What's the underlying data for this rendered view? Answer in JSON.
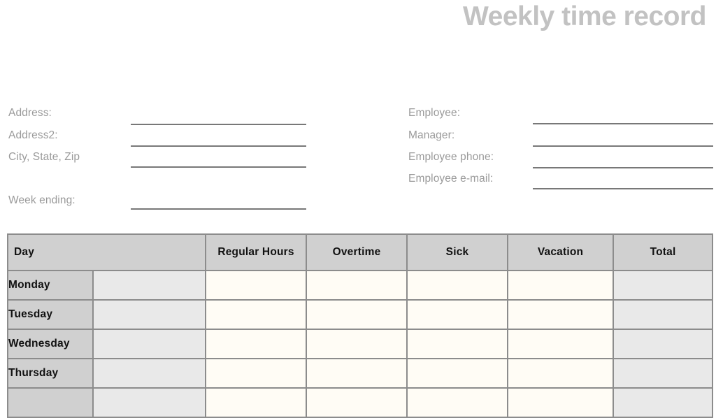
{
  "document": {
    "title": "Weekly time record"
  },
  "form": {
    "left_fields": [
      {
        "label": "Address:"
      },
      {
        "label": "Address2:"
      },
      {
        "label": "City, State, Zip"
      },
      {
        "label": "Week ending:"
      }
    ],
    "right_fields": [
      {
        "label": "Employee:"
      },
      {
        "label": "Manager:"
      },
      {
        "label": "Employee phone:"
      },
      {
        "label": "Employee e-mail:"
      }
    ],
    "input_value": "",
    "input_placeholder": ""
  },
  "table": {
    "headers": [
      "Day",
      "Regular Hours",
      "Overtime",
      "Sick",
      "Vacation",
      "Total"
    ],
    "rows": [
      {
        "day": "Monday",
        "note": "",
        "regular_hours": "",
        "overtime": "",
        "sick": "",
        "vacation": "",
        "total": ""
      },
      {
        "day": "Tuesday",
        "note": "",
        "regular_hours": "",
        "overtime": "",
        "sick": "",
        "vacation": "",
        "total": ""
      },
      {
        "day": "Wednesday",
        "note": "",
        "regular_hours": "",
        "overtime": "",
        "sick": "",
        "vacation": "",
        "total": ""
      },
      {
        "day": "Thursday",
        "note": "",
        "regular_hours": "",
        "overtime": "",
        "sick": "",
        "vacation": "",
        "total": ""
      },
      {
        "day": "",
        "note": "",
        "regular_hours": "",
        "overtime": "",
        "sick": "",
        "vacation": "",
        "total": ""
      }
    ]
  },
  "colors": {
    "title": "#c2c2c2",
    "label": "#9a9a9a",
    "rule": "#787878",
    "header_fill": "#d0d0d0",
    "gray_cell": "#e9e9e9",
    "cream_cell": "#fffcf5",
    "border": "#8c8c8c"
  }
}
